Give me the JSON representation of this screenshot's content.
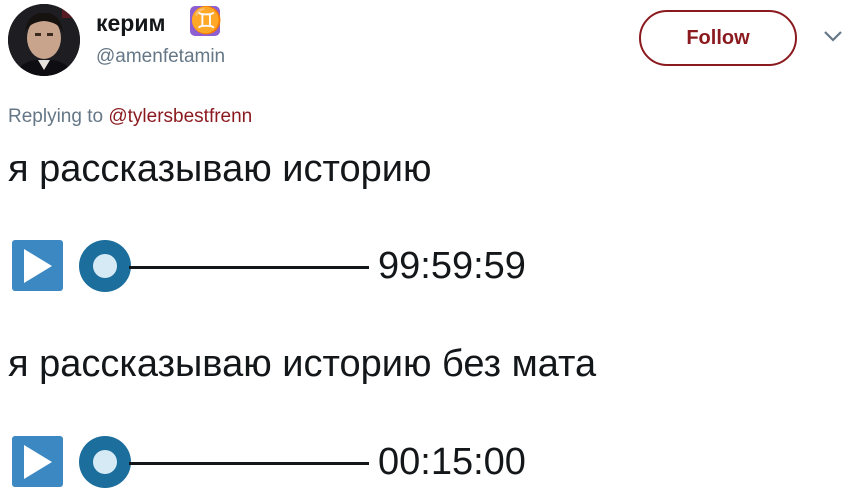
{
  "header": {
    "display_name": "керим",
    "badge_glyph": "♊",
    "username": "@amenfetamin",
    "follow_label": "Follow",
    "accent_color": "#8b1a1f"
  },
  "reply": {
    "prefix": "Replying to ",
    "mention": "@tylersbestfrenn"
  },
  "content": {
    "line1": "я рассказываю историю",
    "player1": {
      "icon": "play-button-icon",
      "knob_icon": "record-button-icon",
      "duration": "99:59:59",
      "progress": 0
    },
    "line2": "я рассказываю историю без мата",
    "player2": {
      "icon": "play-button-icon",
      "knob_icon": "record-button-icon",
      "duration": "00:15:00",
      "progress": 0
    }
  },
  "icons": {
    "avatar": "profile-photo",
    "menu": "chevron-down-icon",
    "badge": "gemini-zodiac-icon"
  },
  "colors": {
    "play_blue": "#3b88c3",
    "knob_blue": "#1c6e9c",
    "text_primary": "#14171a",
    "text_secondary": "#657786"
  }
}
